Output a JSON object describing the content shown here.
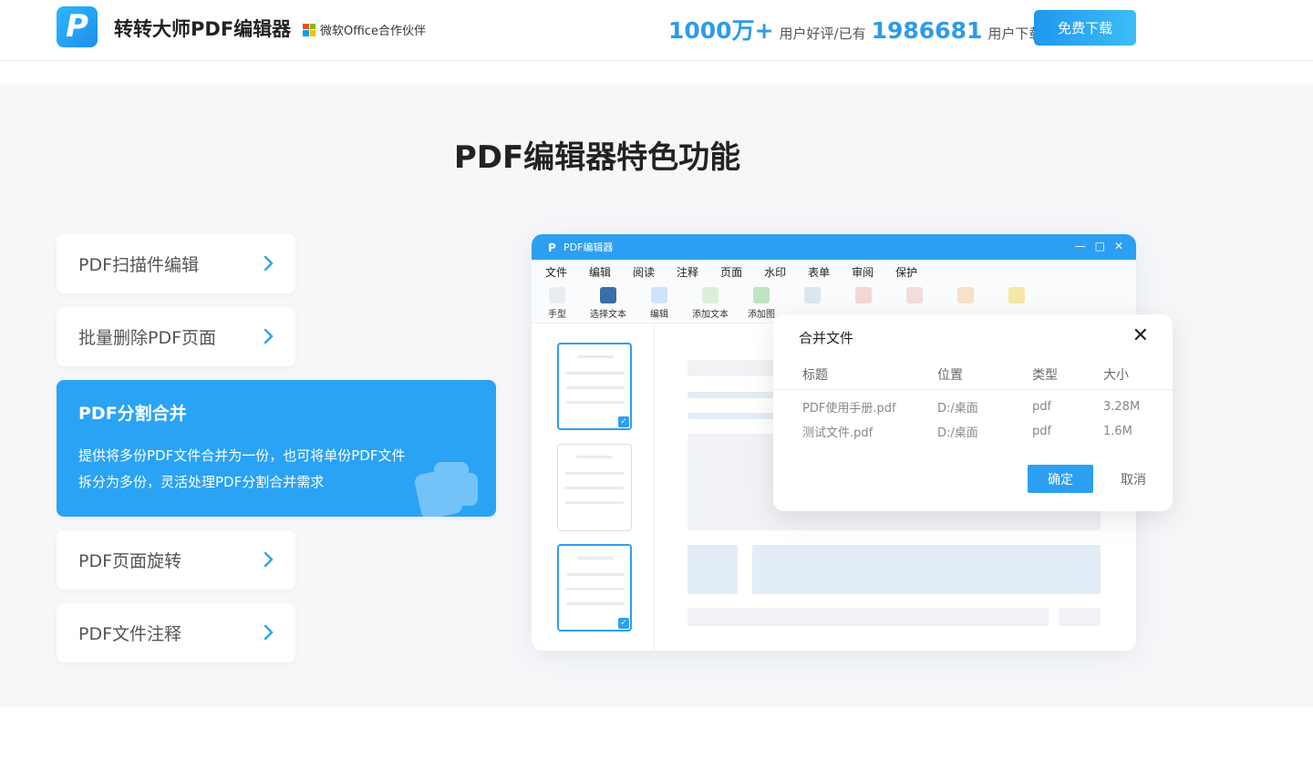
{
  "header": {
    "logo_letter": "P",
    "brand": "转转大师PDF编辑器",
    "partner": "微软Office合作伙伴",
    "stat1_value": "1000万+",
    "stat1_text": "用户好评/已有",
    "stat2_value": "1986681",
    "stat2_text": "用户下载",
    "download_label": "免费下载"
  },
  "section": {
    "title": "PDF编辑器特色功能",
    "features": [
      {
        "label": "PDF扫描件编辑"
      },
      {
        "label": "批量删除PDF页面"
      },
      {
        "label": "PDF分割合并",
        "desc": "提供将多份PDF文件合并为一份，也可将单份PDF文件拆分为多份，灵活处理PDF分割合并需求"
      },
      {
        "label": "PDF页面旋转"
      },
      {
        "label": "PDF文件注释"
      }
    ]
  },
  "app": {
    "title": "PDF编辑器",
    "menu": [
      "文件",
      "编辑",
      "阅读",
      "注释",
      "页面",
      "水印",
      "表单",
      "审阅",
      "保护"
    ],
    "tools": [
      "手型",
      "选择文本",
      "编辑",
      "添加文本",
      "添加图"
    ]
  },
  "dialog": {
    "title": "合并文件",
    "columns": [
      "标题",
      "位置",
      "类型",
      "大小"
    ],
    "rows": [
      [
        "PDF使用手册.pdf",
        "D:/桌面",
        "pdf",
        "3.28M"
      ],
      [
        "测试文件.pdf",
        "D:/桌面",
        "pdf",
        "1.6M"
      ]
    ],
    "ok_label": "确定",
    "cancel_label": "取消"
  },
  "colors": {
    "accent": "#2aa3f5",
    "brand_blue": "#2c9be8"
  }
}
